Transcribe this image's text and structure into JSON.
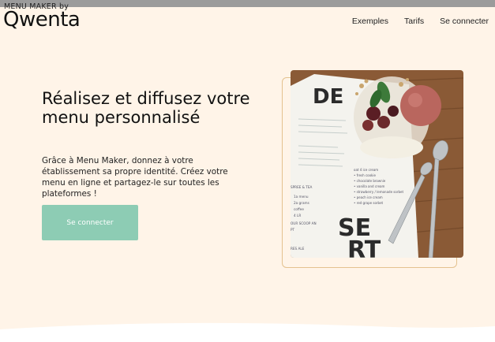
{
  "header": {
    "brand_small": "MENU MAKER by",
    "logo": "Qwenta",
    "nav": [
      {
        "label": "Exemples"
      },
      {
        "label": "Tarifs"
      },
      {
        "label": "Se connecter"
      }
    ]
  },
  "hero": {
    "title": "Réalisez et diffusez votre menu personnalisé",
    "subtitle": "Grâce à Menu Maker, donnez à votre établissement sa propre identité. Créez votre menu en ligne et partagez-le sur toutes les plateformes !",
    "cta_label": "Se connecter"
  },
  "photo": {
    "menu_letters_top": "DE",
    "menu_letters_bottom": "SE\nRT",
    "lines_left": [
      "SPREE & TEA",
      "1a menu",
      "2a grams",
      "coffee",
      "4 LR",
      "OUR SCOOP AN",
      "PT",
      "RES ALE"
    ],
    "lines_right": [
      "oat 4 ice cream",
      "• fresh cookie",
      "• chocolate brownie",
      "• vanilla and cream",
      "• strawberry / lemonade sorbet",
      "• peach ice cream",
      "• red grape sorbet"
    ]
  },
  "colors": {
    "background": "#fff4e8",
    "cta": "#8dccb4",
    "frame": "#e4c28f"
  }
}
